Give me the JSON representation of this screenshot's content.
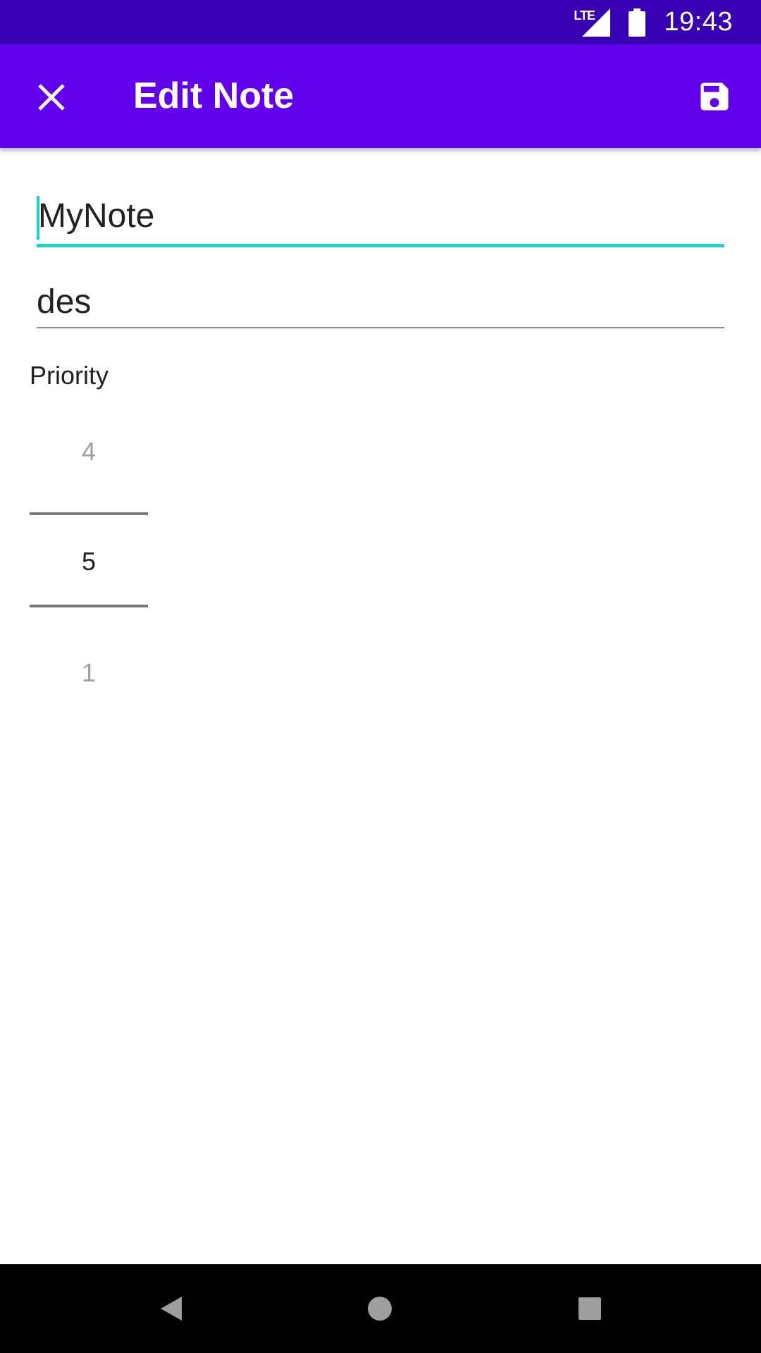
{
  "status_bar": {
    "network_label": "LTE",
    "time": "19:43"
  },
  "app_bar": {
    "title": "Edit Note",
    "close_icon": "close-icon",
    "save_icon": "save-icon"
  },
  "form": {
    "title_value": "MyNote",
    "description_value": "des",
    "priority_label": "Priority",
    "priority_picker": {
      "previous": "4",
      "current": "5",
      "next": "1"
    }
  },
  "nav_bar": {
    "back_icon": "back-icon",
    "home_icon": "home-icon",
    "recents_icon": "recents-icon"
  },
  "colors": {
    "status_bar": "#3700B3",
    "app_bar": "#6200EE",
    "accent": "#1FD3C6"
  }
}
